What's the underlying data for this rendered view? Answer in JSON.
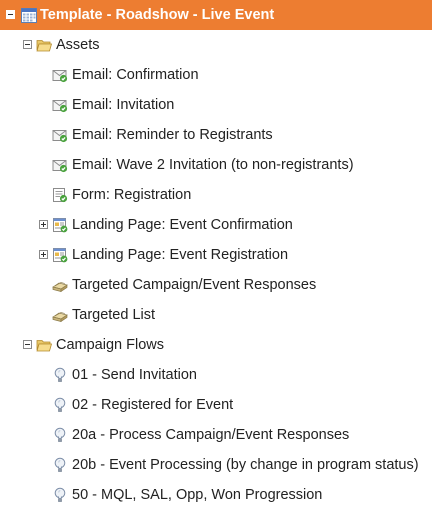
{
  "colors": {
    "header_bg": "#ed7d31",
    "header_text": "#ffffff"
  },
  "program": {
    "title": "Template - Roadshow - Live Event",
    "icon": "calendar-icon"
  },
  "folders": [
    {
      "label": "Assets",
      "icon": "folder-icon",
      "items": [
        {
          "label": "Email: Confirmation",
          "icon": "email-icon"
        },
        {
          "label": "Email: Invitation",
          "icon": "email-icon"
        },
        {
          "label": "Email: Reminder to Registrants",
          "icon": "email-icon"
        },
        {
          "label": "Email: Wave 2 Invitation (to non-registrants)",
          "icon": "email-icon"
        },
        {
          "label": "Form: Registration",
          "icon": "form-icon"
        },
        {
          "label": "Landing Page: Event Confirmation",
          "icon": "landing-page-icon",
          "expandable": true
        },
        {
          "label": "Landing Page: Event Registration",
          "icon": "landing-page-icon",
          "expandable": true
        },
        {
          "label": "Targeted Campaign/Event Responses",
          "icon": "list-icon"
        },
        {
          "label": "Targeted List",
          "icon": "list-icon"
        }
      ]
    },
    {
      "label": "Campaign Flows",
      "icon": "folder-icon",
      "items": [
        {
          "label": "01 - Send Invitation",
          "icon": "smart-campaign-icon"
        },
        {
          "label": "02 - Registered for Event",
          "icon": "smart-campaign-icon"
        },
        {
          "label": "20a - Process Campaign/Event Responses",
          "icon": "smart-campaign-icon"
        },
        {
          "label": "20b - Event Processing (by change in program status)",
          "icon": "smart-campaign-icon"
        },
        {
          "label": "50 - MQL, SAL, Opp, Won Progression",
          "icon": "smart-campaign-icon"
        }
      ]
    }
  ]
}
